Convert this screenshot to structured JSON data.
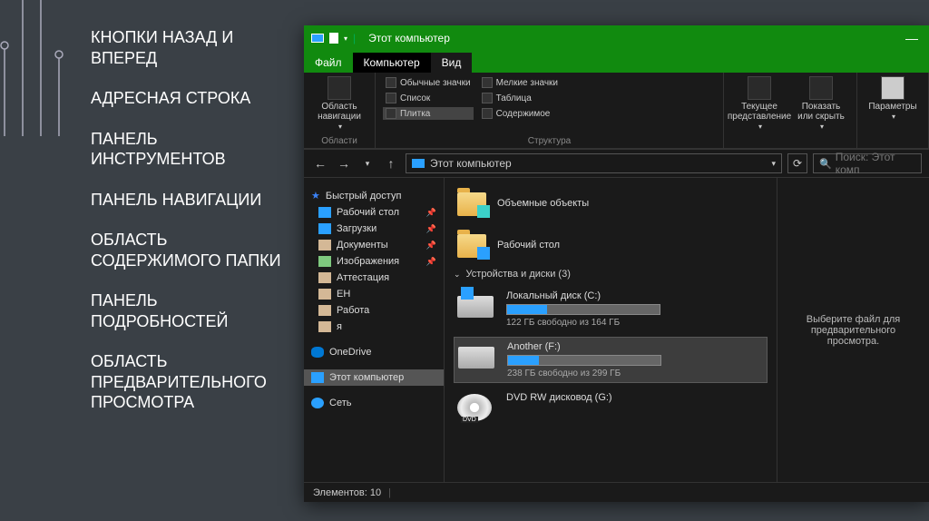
{
  "labels": [
    "Кнопки назад и вперед",
    "Адресная строка",
    "Панель инструментов",
    "Панель навигации",
    "Область содержимого папки",
    "Панель подробностей",
    "Область предварительного просмотра"
  ],
  "window": {
    "title": "Этот компьютер",
    "tabs": {
      "file": "Файл",
      "computer": "Компьютер",
      "view": "Вид"
    },
    "ribbon": {
      "nav_pane": "Область навигации",
      "group_areas": "Области",
      "icons_normal": "Обычные значки",
      "icons_small": "Мелкие значки",
      "list": "Список",
      "table": "Таблица",
      "tiles": "Плитка",
      "content": "Содержимое",
      "group_layout": "Структура",
      "current_view": "Текущее представление",
      "show_hide": "Показать или скрыть",
      "options": "Параметры"
    },
    "address": {
      "path": "Этот компьютер",
      "search_placeholder": "Поиск: Этот комп"
    },
    "nav": {
      "quick": "Быстрый доступ",
      "desktop": "Рабочий стол",
      "downloads": "Загрузки",
      "documents": "Документы",
      "pictures": "Изображения",
      "f1": "Аттестация",
      "f2": "ЕН",
      "f3": "Работа",
      "f4": "я",
      "onedrive": "OneDrive",
      "thispc": "Этот компьютер",
      "network": "Сеть"
    },
    "content": {
      "obj3d": "Объемные объекты",
      "desktop": "Рабочий стол",
      "devices_header": "Устройства и диски (3)",
      "driveC": {
        "name": "Локальный диск (C:)",
        "sub": "122 ГБ свободно из 164 ГБ",
        "fill": 26
      },
      "driveF": {
        "name": "Another (F:)",
        "sub": "238 ГБ свободно из 299 ГБ",
        "fill": 20
      },
      "dvd": "DVD RW дисковод (G:)"
    },
    "preview": "Выберите файл для предварительного просмотра.",
    "status": {
      "count": "Элементов: 10"
    }
  }
}
